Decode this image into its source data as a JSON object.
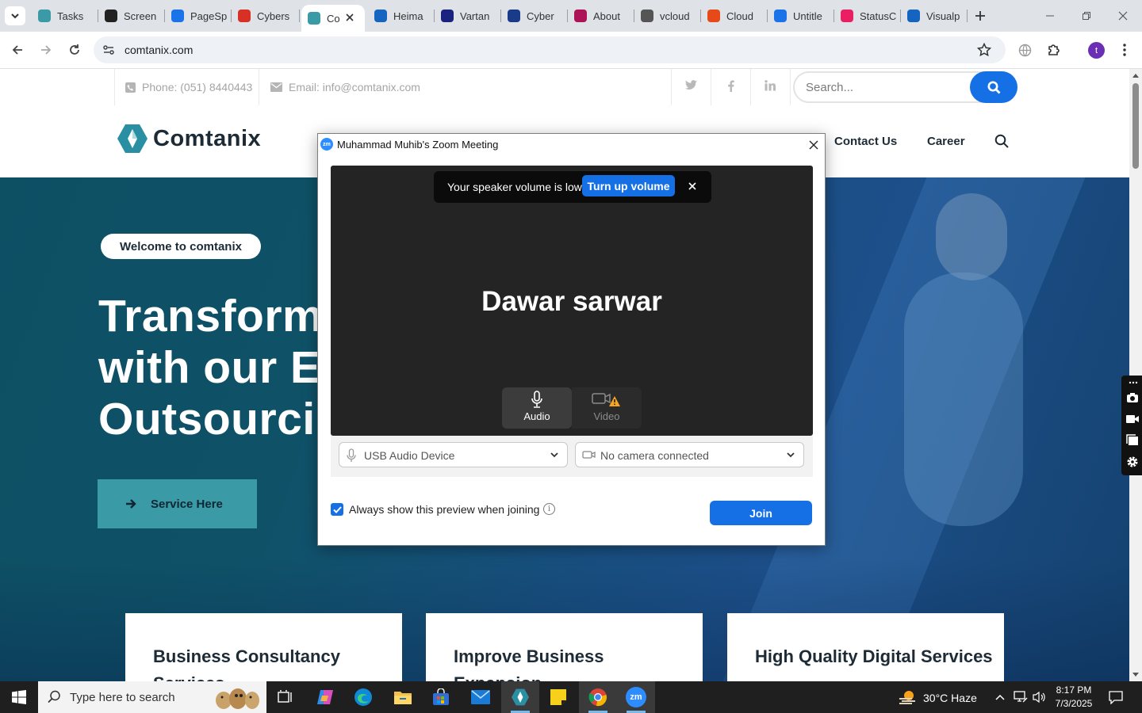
{
  "browser": {
    "tabs": [
      {
        "title": "Tasks",
        "color": "#3a9aa6"
      },
      {
        "title": "Screen",
        "color": "#222222"
      },
      {
        "title": "PageSp",
        "color": "#1a73e8"
      },
      {
        "title": "Cybers",
        "color": "#d93025"
      },
      {
        "title": "Co",
        "color": "#3a9aa6",
        "active": true
      },
      {
        "title": "Heima",
        "color": "#1565c0"
      },
      {
        "title": "Vartan",
        "color": "#1a237e"
      },
      {
        "title": "Cyber",
        "color": "#1a3a8a"
      },
      {
        "title": "About",
        "color": "#ad1457"
      },
      {
        "title": "vcloud",
        "color": "#555555"
      },
      {
        "title": "Cloud",
        "color": "#e64a19"
      },
      {
        "title": "Untitle",
        "color": "#1a73e8"
      },
      {
        "title": "StatusC",
        "color": "#e91e63"
      },
      {
        "title": "Visualp",
        "color": "#1565c0"
      }
    ],
    "url": "comtanix.com",
    "avatar_letter": "t"
  },
  "site": {
    "phone": "Phone: (051) 8440443",
    "email": "Email: info@comtanix.com",
    "search_placeholder": "Search...",
    "logo": "Comtanix",
    "nav": {
      "contact": "Contact Us",
      "career": "Career"
    },
    "welcome": "Welcome to comtanix",
    "hero_lines": [
      "Transform y",
      "with our Ex",
      "Outsourcin"
    ],
    "service_button": "Service Here",
    "cards": [
      {
        "title": "Business Consultancy Services"
      },
      {
        "title": "Improve Business Expansion"
      },
      {
        "title": "High Quality Digital Services"
      }
    ]
  },
  "zoom": {
    "title": "Muhammad Muhib's Zoom Meeting",
    "logo_text": "zm",
    "toast_text": "Your speaker volume is low.",
    "toast_button": "Turn up volume",
    "participant": "Dawar sarwar",
    "audio_label": "Audio",
    "video_label": "Video",
    "mic_device": "USB Audio Device",
    "camera_device": "No camera connected",
    "preview_checkbox": "Always show this preview when joining",
    "join_button": "Join"
  },
  "taskbar": {
    "search_placeholder": "Type here to search",
    "weather": "30°C  Haze",
    "time": "8:17 PM",
    "date": "7/3/2025"
  }
}
